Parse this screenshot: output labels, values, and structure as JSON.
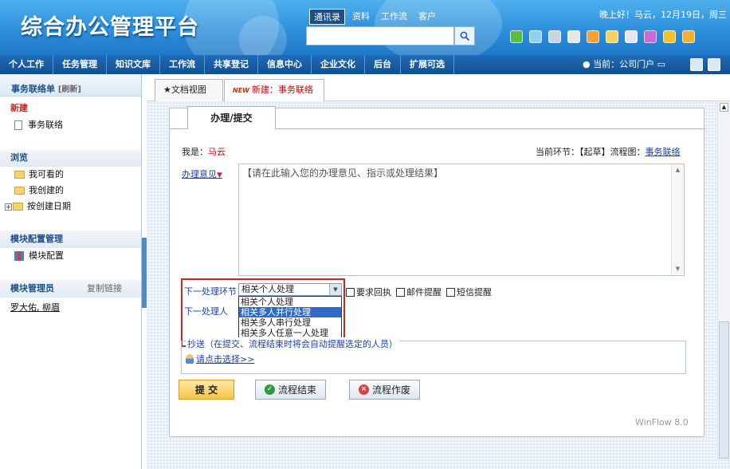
{
  "app": {
    "title": "综合办公管理平台"
  },
  "header": {
    "top_tabs": [
      "通讯录",
      "资料",
      "工作流",
      "客户"
    ],
    "active_top_tab": 0,
    "greeting": "晚上好！马云，12月19日，周三"
  },
  "nav": {
    "items": [
      "个人工作",
      "任务管理",
      "知识文库",
      "工作流",
      "共享登记",
      "信息中心",
      "企业文化",
      "后台",
      "扩展可选"
    ],
    "current": "当前：公司门户"
  },
  "sidebar": {
    "title": "事务联络单",
    "refresh": "[刷新]",
    "new_section": "新建",
    "new_item": "事务联络",
    "browse_section": "浏览",
    "browse_items": [
      "我可看的",
      "我创建的",
      "按创建日期"
    ],
    "config_section": "模块配置管理",
    "config_item": "模块配置",
    "admin_section": "模块管理员",
    "copy_link": "复制链接",
    "admins": "罗大佑, 柳眉"
  },
  "tabs": [
    {
      "label": "★文档视图"
    },
    {
      "badge": "NEW",
      "label": "新建：事务联络"
    }
  ],
  "form": {
    "subtab": "办理/提交",
    "me_label": "我是：",
    "me_name": "马云",
    "current_step": "当前环节：【起草】流程图：",
    "flow_link": "事务联络",
    "opinion_label": "办理意见",
    "opinion_placeholder": "【请在此输入您的办理意见、指示或处理结果】",
    "next_step_label": "下一处理环节",
    "next_person_label": "下一处理人",
    "select_value": "相关个人处理",
    "options": [
      "相关个人处理",
      "相关多人并行处理",
      "相关多人串行处理",
      "相关多人任意一人处理"
    ],
    "selected_option": 1,
    "checks": [
      "要求回执",
      "邮件提醒",
      "短信提醒"
    ],
    "cc_title": "抄送（在提交、流程结束时将会自动提醒选定的人员）",
    "cc_pick": "请点击选择>>",
    "buttons": {
      "submit": "提 交",
      "finish": "流程结束",
      "void": "流程作废"
    },
    "footer": "WinFlow 8.0"
  }
}
